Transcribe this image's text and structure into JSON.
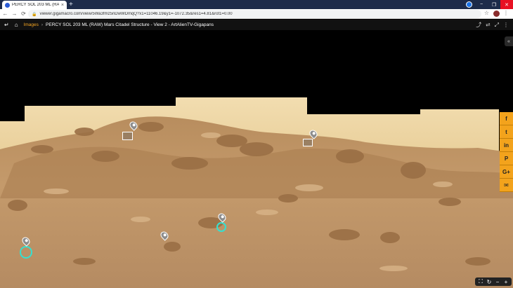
{
  "browser": {
    "tab_title": "PERCY SOL 203 ML (RAW) Mars",
    "tab_close": "×",
    "new_tab": "+",
    "url": "viewer.gigamacro.com/view/5Wa3fmz5nDwWDmqQ?x1=11046.19&y1=-1072.35&res1=4.81&rot1=0.00",
    "window_minimize": "−",
    "window_restore": "❐",
    "window_close": "✕"
  },
  "nav": {
    "back": "←",
    "forward": "→",
    "reload": "⟳",
    "star": "☆",
    "menu": "⋮"
  },
  "viewer_header": {
    "back_icon": "↵",
    "home_icon": "⌂",
    "crumb": "Images",
    "separator": "›",
    "title": "PERCY SOL 203 ML (RAW) Mars Citadel Structure - View 2 - ArtAlienTV-Gigapans",
    "tools": [
      "⤴",
      "⮂",
      "⤢",
      "⋮"
    ]
  },
  "viewer": {
    "collapse_icon": "«",
    "social": [
      {
        "name": "facebook",
        "label": "f"
      },
      {
        "name": "twitter",
        "label": "t"
      },
      {
        "name": "linkedin",
        "label": "in"
      },
      {
        "name": "pinterest",
        "label": "P"
      },
      {
        "name": "google-plus",
        "label": "G+"
      },
      {
        "name": "email",
        "label": "✉"
      }
    ],
    "zoom": {
      "fit": "⛶",
      "rotate": "↻",
      "zoom_out": "−",
      "zoom_in": "+"
    }
  }
}
